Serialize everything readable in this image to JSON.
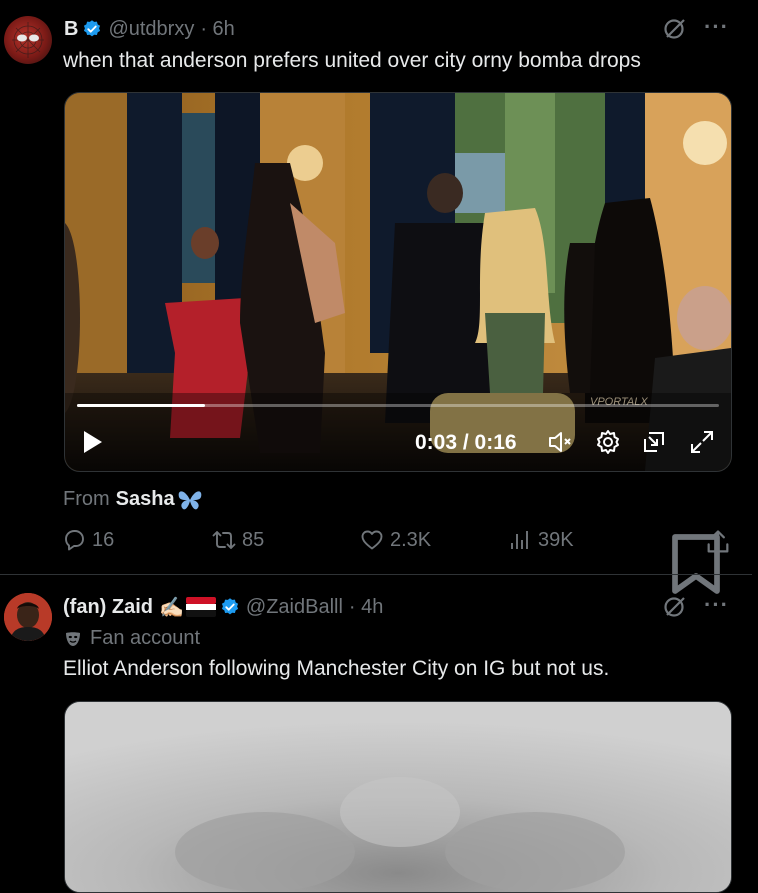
{
  "tweet1": {
    "display_name": "B",
    "handle": "@utdbrxy",
    "time": "· 6h",
    "text": "when that anderson prefers united over city orny bomba drops",
    "video": {
      "time_display": "0:03 / 0:16",
      "watermark": "VPORTALX",
      "progress": 0.2
    },
    "from_label": "From",
    "from_name": "Sasha",
    "from_emoji": "🦋",
    "replies": "16",
    "reposts": "85",
    "likes": "2.3K",
    "views": "39K"
  },
  "tweet2": {
    "display_name": "(fan) Zaid",
    "emoji": "✍🏻",
    "handle": "@ZaidBalll",
    "time": "· 4h",
    "badge_label": "Fan account",
    "text": "Elliot Anderson following Manchester City on IG but not us."
  },
  "colors": {
    "background": "#000000",
    "text": "#e7e9ea",
    "muted": "#71767b",
    "verified": "#1d9bf0",
    "divider": "#2f3336"
  },
  "icons": [
    "verified-badge-icon",
    "grok-icon",
    "more-icon",
    "play-icon",
    "mute-icon",
    "settings-icon",
    "pip-icon",
    "fullscreen-icon",
    "reply-icon",
    "repost-icon",
    "like-icon",
    "views-icon",
    "bookmark-icon",
    "share-icon",
    "butterfly-icon",
    "mask-icon"
  ]
}
